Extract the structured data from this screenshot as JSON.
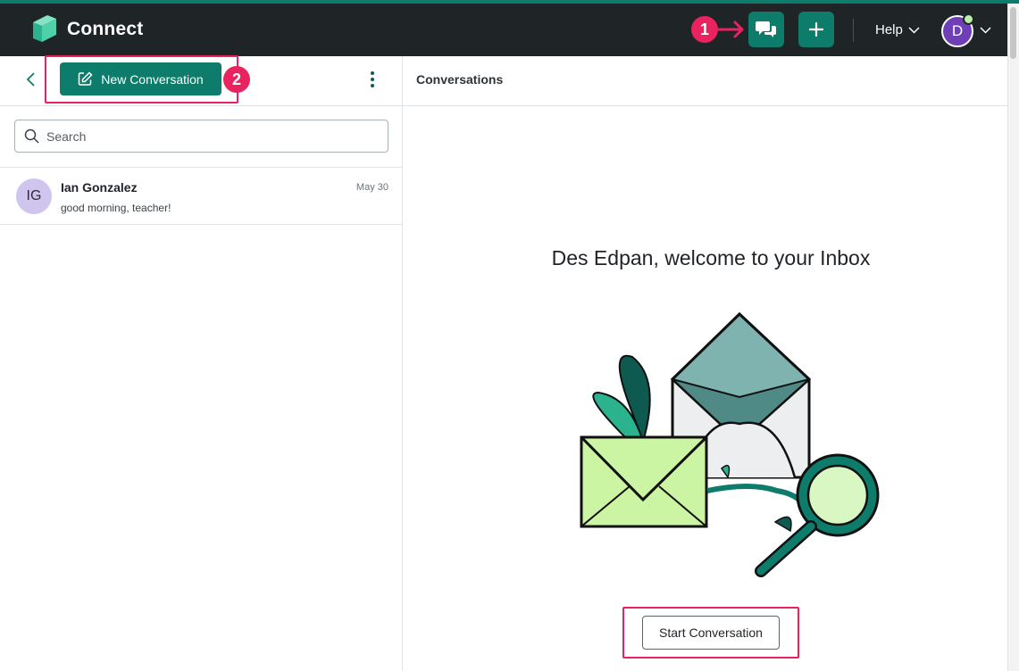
{
  "app": {
    "title": "Connect",
    "accent_color": "#0e7c6b",
    "header_bg": "#1f2426"
  },
  "topbar": {
    "chat_icon": "chat-bubbles-icon",
    "add_icon": "plus-icon",
    "help_label": "Help",
    "user_initial": "D",
    "user_avatar_color": "#6e3fb6",
    "presence_color": "#b8f0a4"
  },
  "annotations": {
    "marker_1": "1",
    "marker_2": "2",
    "marker_color": "#e8235f"
  },
  "sidebar": {
    "new_conversation_label": "New Conversation",
    "search_placeholder": "Search",
    "conversations": [
      {
        "initials": "IG",
        "name": "Ian Gonzalez",
        "preview": "good morning, teacher!",
        "date": "May 30"
      }
    ]
  },
  "main": {
    "header_title": "Conversations",
    "welcome_text": "Des Edpan, welcome to your Inbox",
    "start_button_label": "Start Conversation"
  }
}
